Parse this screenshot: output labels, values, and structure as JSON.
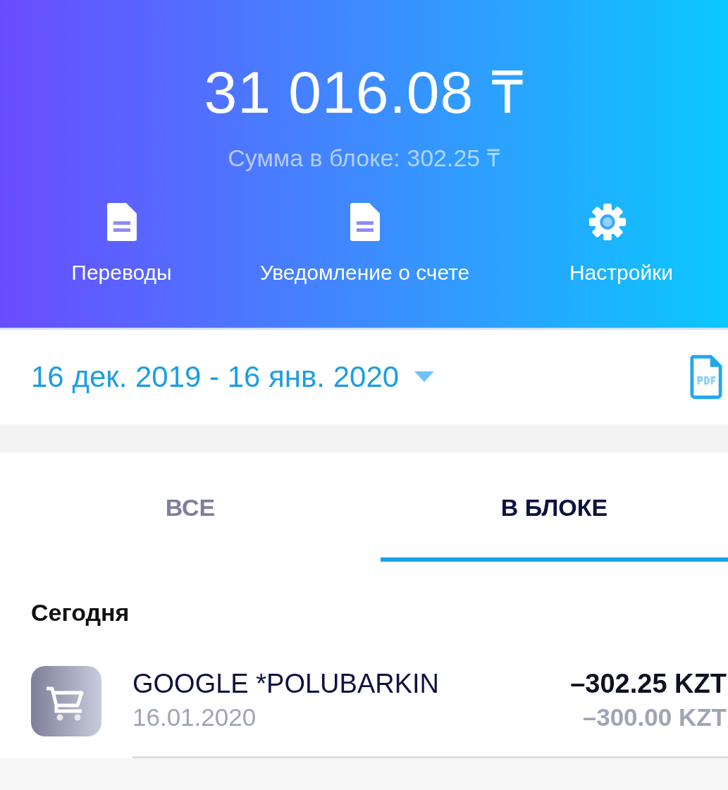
{
  "balance": "31 016.08 ₸",
  "blocked": "Сумма в блоке: 302.25 ₸",
  "actions": [
    {
      "kind": "document",
      "label": "Переводы"
    },
    {
      "kind": "document",
      "label": "Уведомление о счете"
    },
    {
      "kind": "settings",
      "label": "Настройки"
    }
  ],
  "period": "16 дек. 2019 - 16 янв. 2020",
  "tabs": [
    {
      "label": "ВСЕ",
      "selected": false
    },
    {
      "label": "В БЛОКЕ",
      "selected": true
    }
  ],
  "section": "Сегодня",
  "transactions": [
    {
      "name": "GOOGLE *POLUBARKIN",
      "date": "16.01.2020",
      "amount": "–302.25 KZT",
      "original": "–300.00 KZT"
    }
  ]
}
